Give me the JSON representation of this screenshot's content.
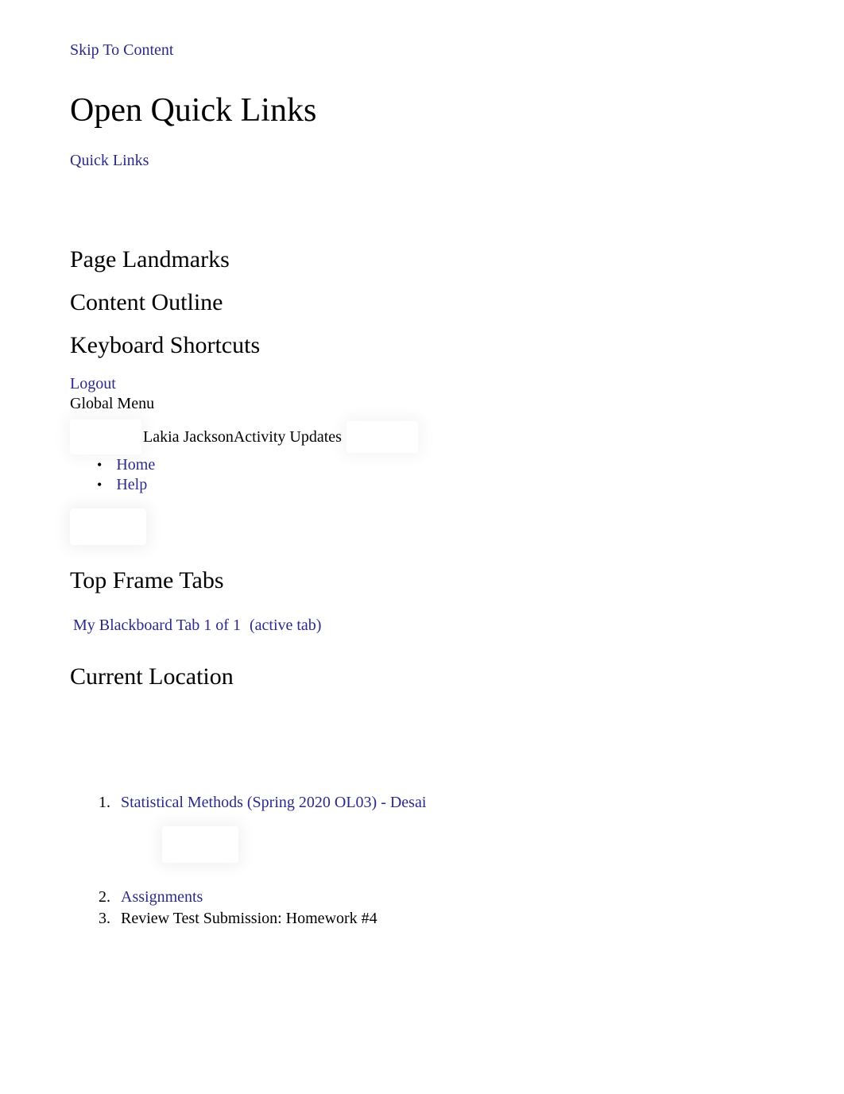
{
  "skip_link": "Skip To Content",
  "main_heading": "Open Quick Links",
  "quick_links": "Quick Links",
  "sections": {
    "page_landmarks": "Page Landmarks",
    "content_outline": "Content Outline",
    "keyboard_shortcuts": "Keyboard Shortcuts"
  },
  "logout": "Logout",
  "global_menu_label": "Global Menu",
  "user_name": "Lakia Jackson",
  "activity_updates": "Activity Updates",
  "nav_items": {
    "home": "Home",
    "help": "Help"
  },
  "top_frame_tabs_heading": "Top Frame Tabs",
  "tab": {
    "label": "My Blackboard Tab 1 of 1",
    "suffix": "(active tab)"
  },
  "current_location_heading": "Current Location",
  "breadcrumbs": {
    "course": "Statistical Methods (Spring 2020 OL03) - Desai",
    "assignments": "Assignments",
    "review": "Review Test Submission: Homework #4"
  }
}
